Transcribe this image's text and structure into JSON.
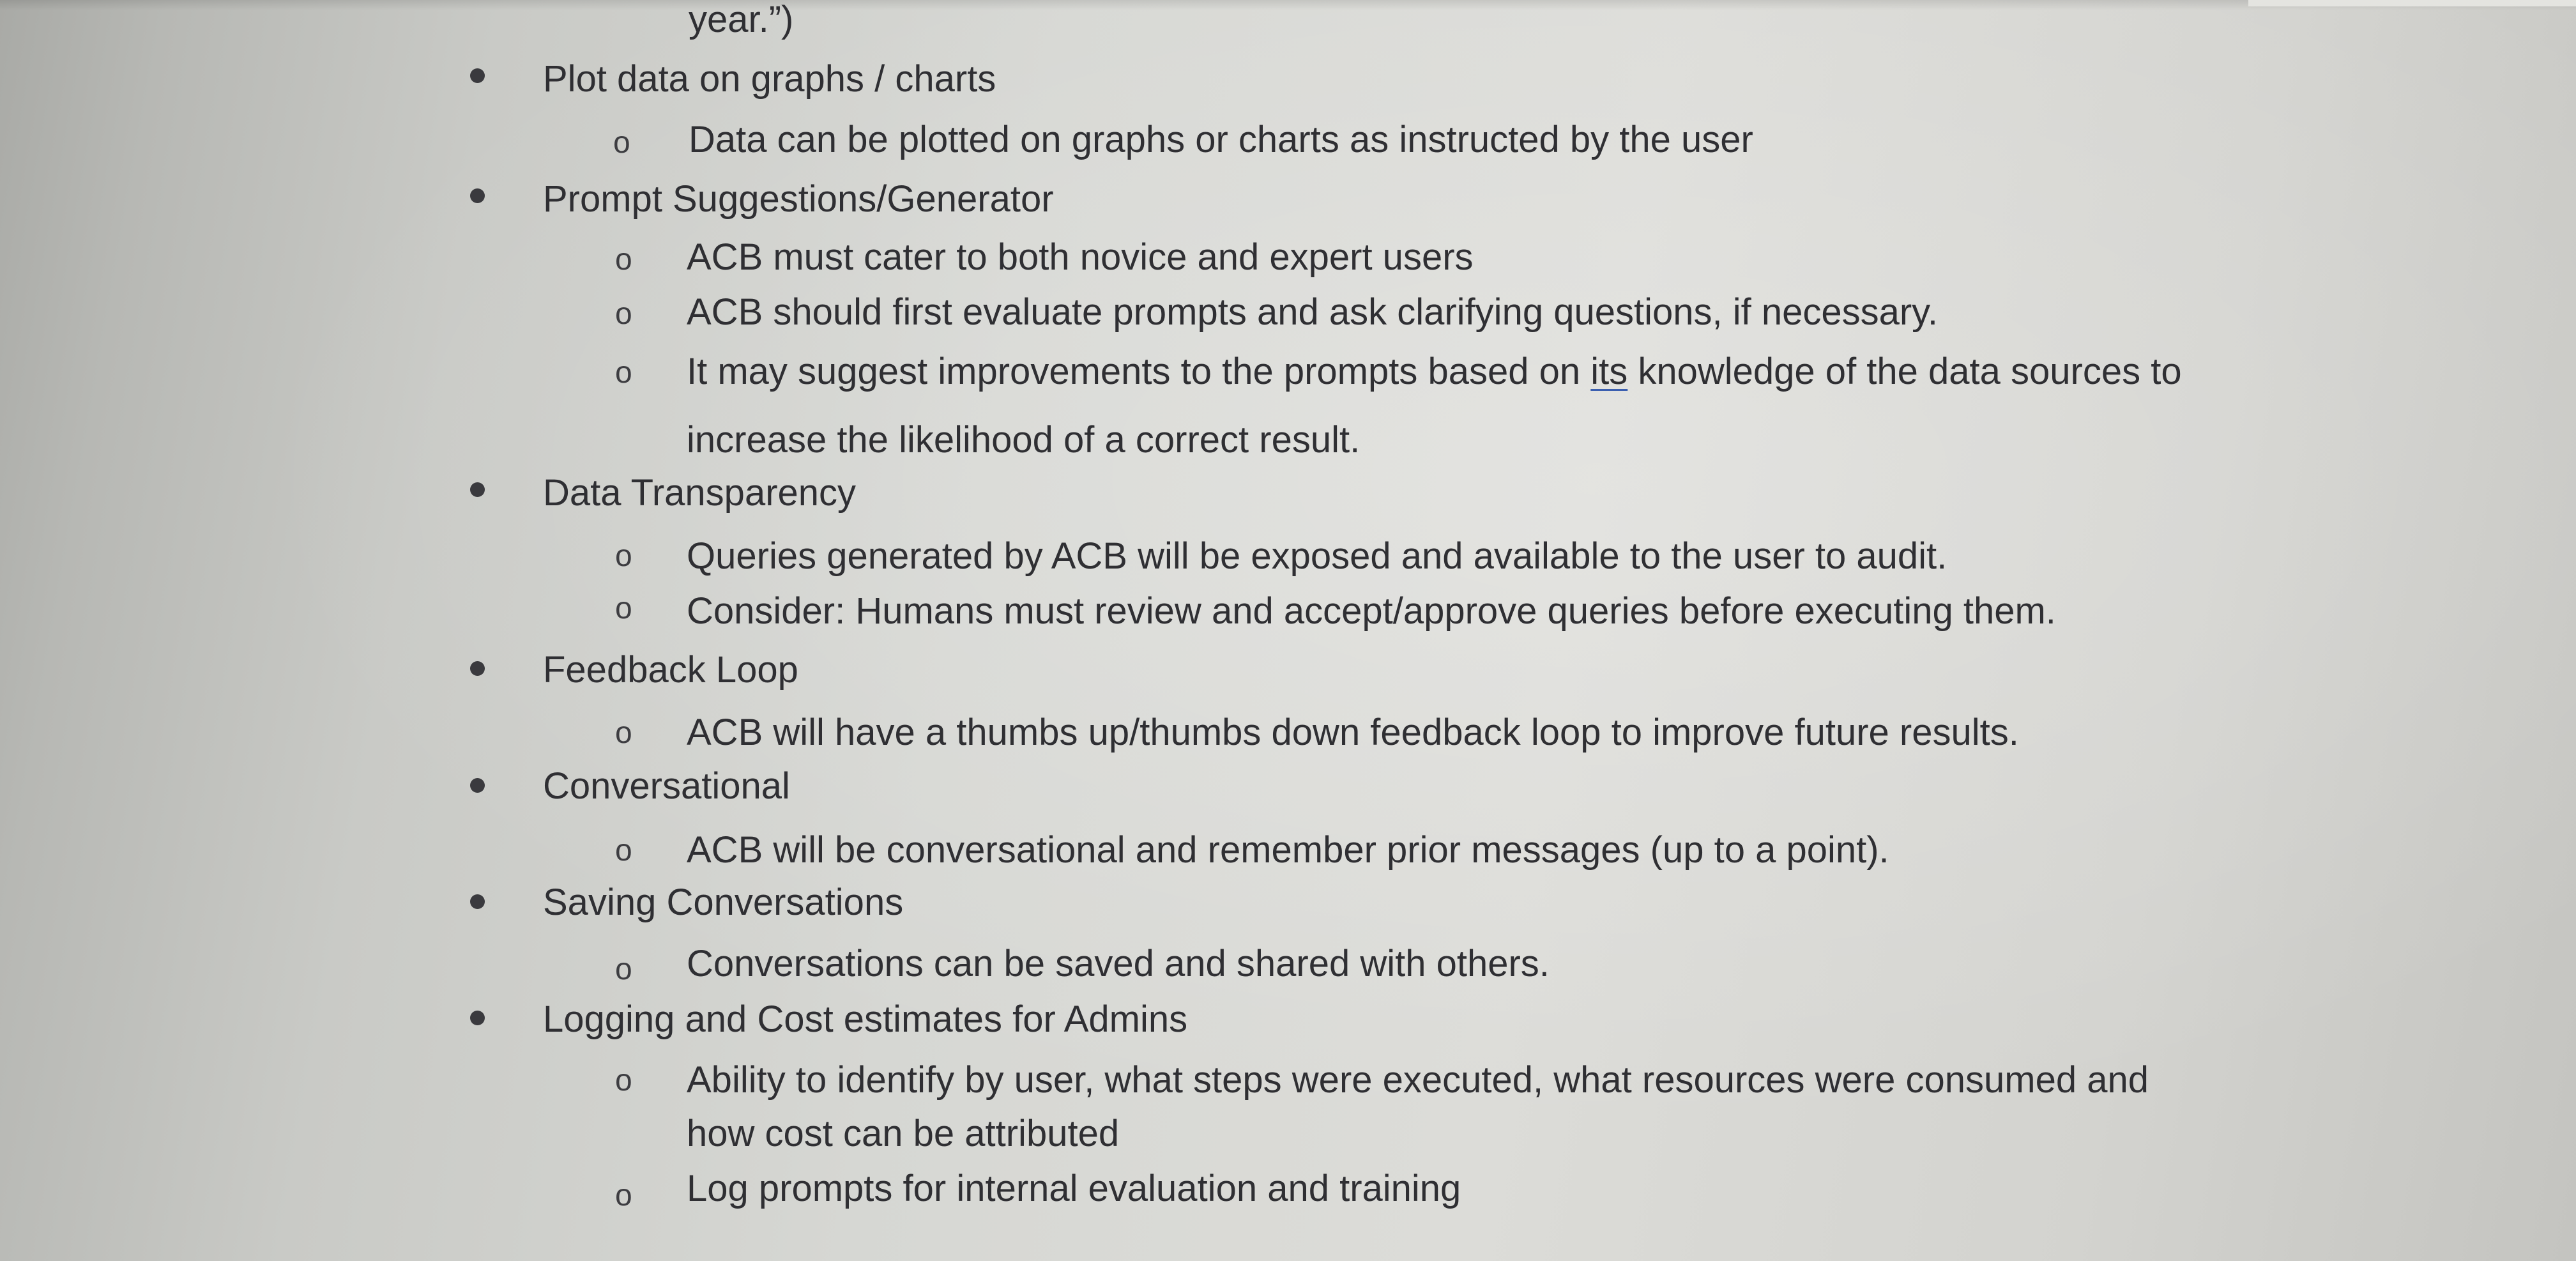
{
  "document": {
    "lead_line": "year.”)",
    "sections": [
      {
        "heading": "Plot data on graphs / charts",
        "items": [
          {
            "text": "Data can be plotted on graphs or charts as instructed by the user"
          }
        ]
      },
      {
        "heading": "Prompt Suggestions/Generator",
        "items": [
          {
            "text": "ACB must cater to both novice and expert users"
          },
          {
            "text": "ACB should first evaluate prompts and ask clarifying questions, if necessary."
          },
          {
            "text_before": "It may suggest improvements to the prompts based on ",
            "text_underlined": "its",
            "text_after": " knowledge of the data sources to",
            "text_cont": "increase the likelihood of a correct result."
          }
        ]
      },
      {
        "heading": "Data Transparency",
        "items": [
          {
            "text": "Queries generated by ACB will be exposed and available to the user to audit."
          },
          {
            "text": "Consider: Humans must review and accept/approve queries before executing them."
          }
        ]
      },
      {
        "heading": "Feedback Loop",
        "items": [
          {
            "text": "ACB will have a thumbs up/thumbs down feedback loop to improve future results."
          }
        ]
      },
      {
        "heading": "Conversational",
        "items": [
          {
            "text": "ACB will be conversational and remember prior messages (up to a point)."
          }
        ]
      },
      {
        "heading": "Saving Conversations",
        "items": [
          {
            "text": "Conversations can be saved and shared with others."
          }
        ]
      },
      {
        "heading": "Logging and Cost estimates for Admins",
        "items": [
          {
            "text": "Ability to identify by user, what steps were executed, what resources were consumed and",
            "text_cont": "how cost can be attributed"
          },
          {
            "text": "Log prompts for internal evaluation and training"
          }
        ]
      }
    ]
  }
}
